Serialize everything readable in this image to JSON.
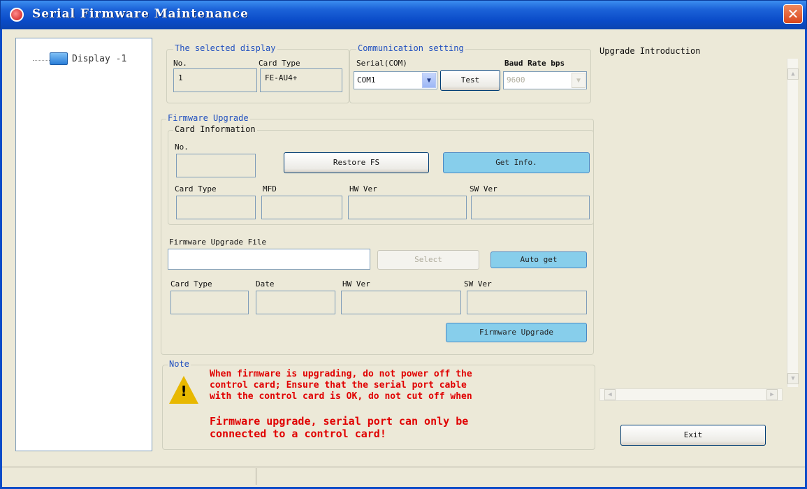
{
  "window": {
    "title": "Serial Firmware Maintenance"
  },
  "tree": {
    "items": [
      {
        "label": "Display -1"
      }
    ]
  },
  "selected_display": {
    "title": "The selected display",
    "no_label": "No.",
    "no_value": "1",
    "card_type_label": "Card Type",
    "card_type_value": "FE-AU4+"
  },
  "communication": {
    "title": "Communication setting",
    "serial_label": "Serial(COM)",
    "serial_value": "COM1",
    "test_button": "Test",
    "baud_label": "Baud Rate bps",
    "baud_value": "9600"
  },
  "firmware_upgrade": {
    "title": "Firmware Upgrade",
    "card_info": {
      "title": "Card Information",
      "no_label": "No.",
      "restore_button": "Restore FS",
      "get_info_button": "Get Info.",
      "card_type_label": "Card Type",
      "mfd_label": "MFD",
      "hw_label": "HW Ver",
      "sw_label": "SW Ver"
    },
    "file": {
      "label": "Firmware Upgrade File",
      "value": "",
      "select_button": "Select",
      "auto_get_button": "Auto get",
      "card_type_label": "Card Type",
      "date_label": "Date",
      "hw_label": "HW Ver",
      "sw_label": "SW Ver"
    },
    "upgrade_button": "Firmware Upgrade"
  },
  "note": {
    "title": "Note",
    "line1": "When firmware is upgrading, do not power off the",
    "line2": "control card; Ensure that the serial port cable",
    "line3": "with the control card is OK, do not cut off when",
    "line4": "Firmware upgrade, serial port can only be",
    "line5": "connected to a control card!"
  },
  "intro": {
    "title": "Upgrade Introduction"
  },
  "exit_button": "Exit",
  "icons": {
    "app": "app-logo-icon",
    "close": "close-icon",
    "display": "monitor-icon",
    "warning": "warning-icon"
  },
  "colors": {
    "accent_blue": "#87ceeb",
    "title_bar": "#0a4bc8",
    "note_red": "#e00000",
    "group_title": "#1f4fbf"
  }
}
